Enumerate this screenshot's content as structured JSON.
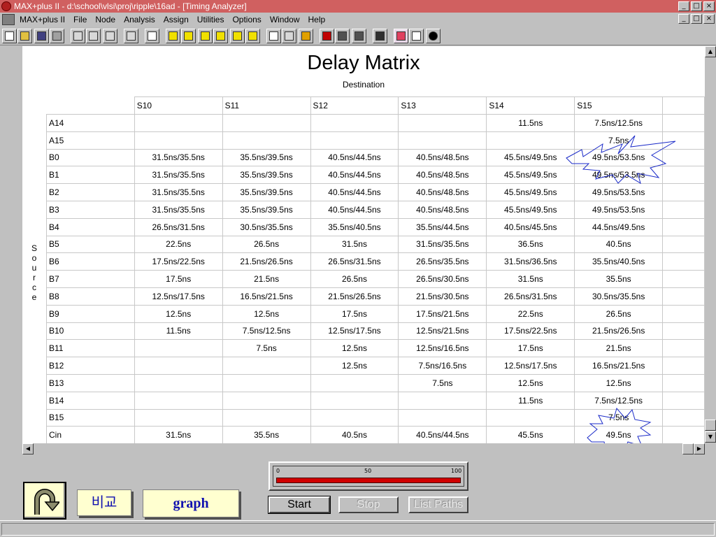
{
  "window": {
    "title": "MAX+plus II - d:\\school\\vlsi\\proj\\ripple\\16ad - [Timing Analyzer]",
    "buttons": [
      "_",
      "□",
      "×"
    ]
  },
  "menu": {
    "items": [
      "MAX+plus II",
      "File",
      "Node",
      "Analysis",
      "Assign",
      "Utilities",
      "Options",
      "Window",
      "Help"
    ],
    "buttons": [
      "_",
      "□",
      "×"
    ]
  },
  "matrix": {
    "title": "Delay Matrix",
    "destination_label": "Destination",
    "source_label": [
      "S",
      "o",
      "u",
      "r",
      "c",
      "e"
    ],
    "columns": [
      "S10",
      "S11",
      "S12",
      "S13",
      "S14",
      "S15",
      ""
    ],
    "rows": [
      {
        "label": "A14",
        "cells": [
          "",
          "",
          "",
          "",
          "11.5ns",
          "7.5ns/12.5ns",
          ""
        ]
      },
      {
        "label": "A15",
        "cells": [
          "",
          "",
          "",
          "",
          "",
          "7.5ns",
          ""
        ]
      },
      {
        "label": "B0",
        "cells": [
          "31.5ns/35.5ns",
          "35.5ns/39.5ns",
          "40.5ns/44.5ns",
          "40.5ns/48.5ns",
          "45.5ns/49.5ns",
          "49.5ns/53.5ns",
          ""
        ]
      },
      {
        "label": "B1",
        "cells": [
          "31.5ns/35.5ns",
          "35.5ns/39.5ns",
          "40.5ns/44.5ns",
          "40.5ns/48.5ns",
          "45.5ns/49.5ns",
          "49.5ns/53.5ns",
          ""
        ]
      },
      {
        "label": "B2",
        "cells": [
          "31.5ns/35.5ns",
          "35.5ns/39.5ns",
          "40.5ns/44.5ns",
          "40.5ns/48.5ns",
          "45.5ns/49.5ns",
          "49.5ns/53.5ns",
          ""
        ]
      },
      {
        "label": "B3",
        "cells": [
          "31.5ns/35.5ns",
          "35.5ns/39.5ns",
          "40.5ns/44.5ns",
          "40.5ns/48.5ns",
          "45.5ns/49.5ns",
          "49.5ns/53.5ns",
          ""
        ]
      },
      {
        "label": "B4",
        "cells": [
          "26.5ns/31.5ns",
          "30.5ns/35.5ns",
          "35.5ns/40.5ns",
          "35.5ns/44.5ns",
          "40.5ns/45.5ns",
          "44.5ns/49.5ns",
          ""
        ]
      },
      {
        "label": "B5",
        "cells": [
          "22.5ns",
          "26.5ns",
          "31.5ns",
          "31.5ns/35.5ns",
          "36.5ns",
          "40.5ns",
          ""
        ]
      },
      {
        "label": "B6",
        "cells": [
          "17.5ns/22.5ns",
          "21.5ns/26.5ns",
          "26.5ns/31.5ns",
          "26.5ns/35.5ns",
          "31.5ns/36.5ns",
          "35.5ns/40.5ns",
          ""
        ]
      },
      {
        "label": "B7",
        "cells": [
          "17.5ns",
          "21.5ns",
          "26.5ns",
          "26.5ns/30.5ns",
          "31.5ns",
          "35.5ns",
          ""
        ]
      },
      {
        "label": "B8",
        "cells": [
          "12.5ns/17.5ns",
          "16.5ns/21.5ns",
          "21.5ns/26.5ns",
          "21.5ns/30.5ns",
          "26.5ns/31.5ns",
          "30.5ns/35.5ns",
          ""
        ]
      },
      {
        "label": "B9",
        "cells": [
          "12.5ns",
          "12.5ns",
          "17.5ns",
          "17.5ns/21.5ns",
          "22.5ns",
          "26.5ns",
          ""
        ]
      },
      {
        "label": "B10",
        "cells": [
          "11.5ns",
          "7.5ns/12.5ns",
          "12.5ns/17.5ns",
          "12.5ns/21.5ns",
          "17.5ns/22.5ns",
          "21.5ns/26.5ns",
          ""
        ]
      },
      {
        "label": "B11",
        "cells": [
          "",
          "7.5ns",
          "12.5ns",
          "12.5ns/16.5ns",
          "17.5ns",
          "21.5ns",
          ""
        ]
      },
      {
        "label": "B12",
        "cells": [
          "",
          "",
          "12.5ns",
          "7.5ns/16.5ns",
          "12.5ns/17.5ns",
          "16.5ns/21.5ns",
          ""
        ]
      },
      {
        "label": "B13",
        "cells": [
          "",
          "",
          "",
          "7.5ns",
          "12.5ns",
          "12.5ns",
          ""
        ]
      },
      {
        "label": "B14",
        "cells": [
          "",
          "",
          "",
          "",
          "11.5ns",
          "7.5ns/12.5ns",
          ""
        ]
      },
      {
        "label": "B15",
        "cells": [
          "",
          "",
          "",
          "",
          "",
          "7.5ns",
          ""
        ]
      },
      {
        "label": "Cin",
        "cells": [
          "31.5ns",
          "35.5ns",
          "40.5ns",
          "40.5ns/44.5ns",
          "45.5ns",
          "49.5ns",
          ""
        ]
      }
    ]
  },
  "progress": {
    "ticks": [
      "0",
      "50",
      "100"
    ],
    "fraction": 1.0,
    "color": "#d00000"
  },
  "controls": {
    "start": "Start",
    "stop": "Stop",
    "list_paths": "List Paths",
    "compare": "비교",
    "graph": "graph"
  }
}
